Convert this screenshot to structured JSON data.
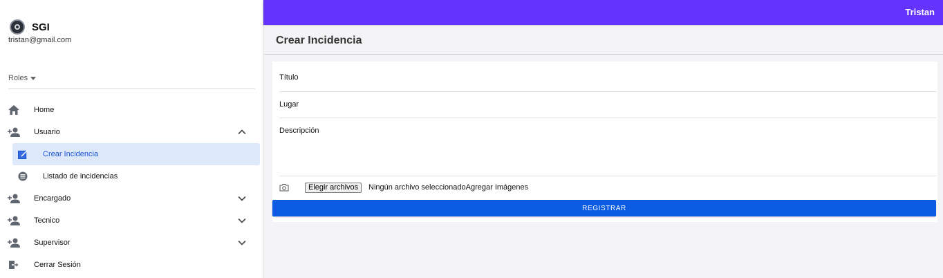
{
  "app": {
    "brand": "SGI",
    "email": "tristan@gmail.com"
  },
  "sidebar": {
    "roles_label": "Roles",
    "items": [
      {
        "label": "Home",
        "icon": "home-icon"
      },
      {
        "label": "Usuario",
        "icon": "add-user-icon",
        "expanded": true
      },
      {
        "label": "Crear Incidencia",
        "icon": "edit-icon",
        "active": true
      },
      {
        "label": "Listado de incidencias",
        "icon": "list-icon"
      },
      {
        "label": "Encargado",
        "icon": "add-user-icon"
      },
      {
        "label": "Tecnico",
        "icon": "add-user-icon"
      },
      {
        "label": "Supervisor",
        "icon": "add-user-icon"
      },
      {
        "label": "Cerrar Sesión",
        "icon": "logout-icon"
      }
    ]
  },
  "topbar": {
    "user": "Tristan",
    "color": "#6434fe"
  },
  "page": {
    "title": "Crear Incidencia"
  },
  "form": {
    "titulo_label": "Título",
    "lugar_label": "Lugar",
    "descripcion_label": "Descripción",
    "file_button": "Elegir archivos",
    "file_status": "Ningún archivo seleccionadoAgregar Imágenes",
    "submit_label": "REGISTRAR"
  },
  "colors": {
    "accent": "#0b5be3",
    "active_bg": "#dde8fb"
  }
}
